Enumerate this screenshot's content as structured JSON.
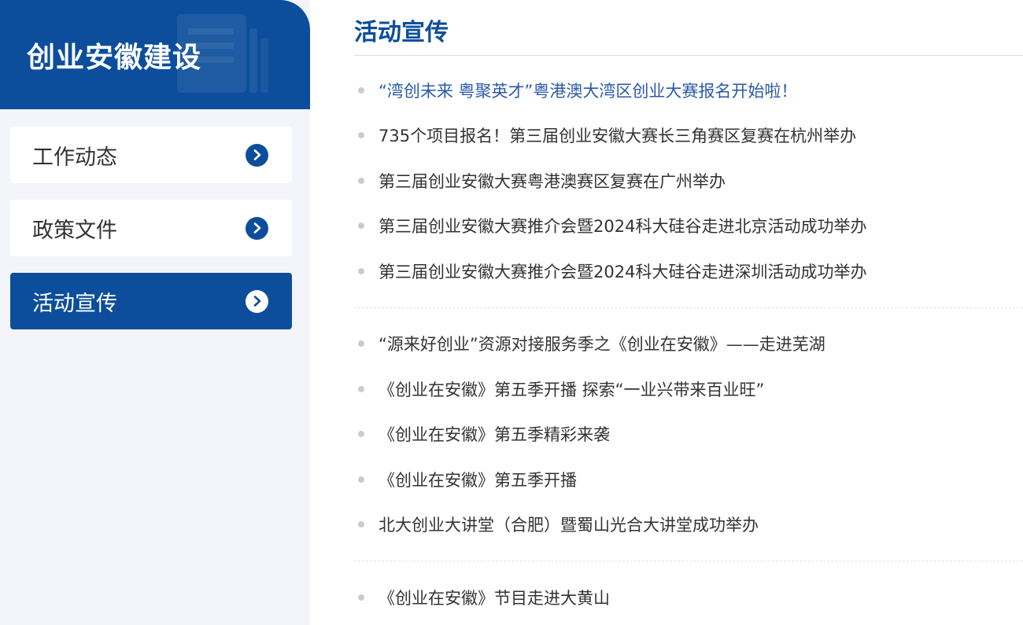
{
  "sidebar": {
    "title": "创业安徽建设",
    "items": [
      {
        "label": "工作动态",
        "active": false
      },
      {
        "label": "政策文件",
        "active": false
      },
      {
        "label": "活动宣传",
        "active": true
      }
    ]
  },
  "main": {
    "title": "活动宣传",
    "groups": [
      [
        "“湾创未来 粤聚英才”粤港澳大湾区创业大赛报名开始啦！",
        "735个项目报名！第三届创业安徽大赛长三角赛区复赛在杭州举办",
        "第三届创业安徽大赛粤港澳赛区复赛在广州举办",
        "第三届创业安徽大赛推介会暨2024科大硅谷走进北京活动成功举办",
        "第三届创业安徽大赛推介会暨2024科大硅谷走进深圳活动成功举办"
      ],
      [
        "“源来好创业”资源对接服务季之《创业在安徽》——走进芜湖",
        "《创业在安徽》第五季开播 探索“一业兴带来百业旺”",
        "《创业在安徽》第五季精彩来袭",
        "《创业在安徽》第五季开播",
        "北大创业大讲堂（合肥）暨蜀山光合大讲堂成功举办"
      ],
      [
        "《创业在安徽》节目走进大黄山"
      ]
    ]
  },
  "colors": {
    "brand": "#0c4e9b",
    "link_highlight": "#2a5aa8",
    "sidebar_bg": "#f3f5fa"
  },
  "icons": {
    "nav_chevron": "chevron-right-circle-icon",
    "header_decoration": "document-icon",
    "bullet": "bullet-dot-icon"
  }
}
